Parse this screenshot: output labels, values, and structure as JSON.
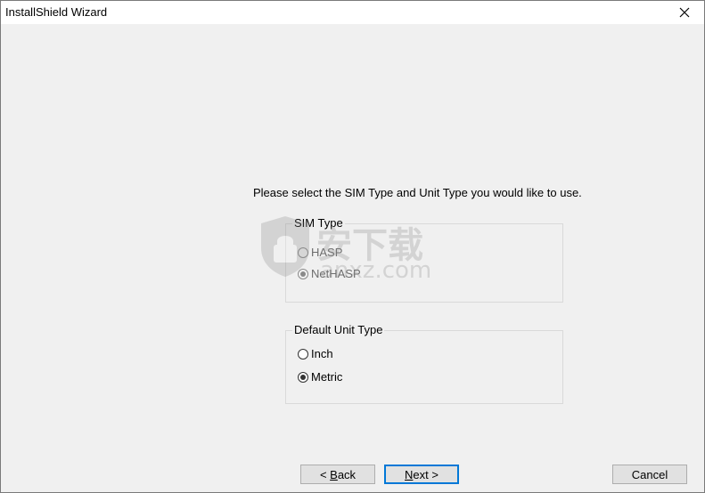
{
  "window": {
    "title": "InstallShield Wizard"
  },
  "prompt": {
    "text": "Please select the SIM Type and Unit Type you would like to use."
  },
  "sim_type": {
    "legend": "SIM Type",
    "disabled": true,
    "options": [
      {
        "label": "HASP",
        "checked": false
      },
      {
        "label": "NetHASP",
        "checked": true
      }
    ]
  },
  "unit_type": {
    "legend": "Default Unit Type",
    "disabled": false,
    "options": [
      {
        "label": "Inch",
        "checked": false
      },
      {
        "label": "Metric",
        "checked": true
      }
    ]
  },
  "buttons": {
    "back_prefix": "< ",
    "back_mnemonic": "B",
    "back_rest": "ack",
    "next_mnemonic": "N",
    "next_rest": "ext >",
    "cancel": "Cancel"
  },
  "watermark": {
    "text": "安下载",
    "domain": "anxz.com"
  },
  "colors": {
    "client_bg": "#f0f0f0",
    "titlebar_bg": "#ffffff",
    "default_button_border": "#0078d7",
    "group_border": "#d9d9d9"
  }
}
